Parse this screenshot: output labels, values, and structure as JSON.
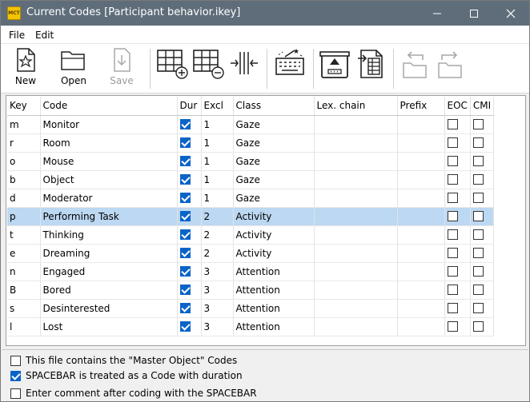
{
  "window": {
    "title": "Current Codes [Participant behavior.ikey]",
    "app_icon_text": "MCT"
  },
  "menu": [
    "File",
    "Edit"
  ],
  "toolbar": {
    "new_label": "New",
    "open_label": "Open",
    "save_label": "Save"
  },
  "table": {
    "headers": [
      "Key",
      "Code",
      "Dur",
      "Excl",
      "Class",
      "Lex. chain",
      "Prefix",
      "EOC",
      "CMI"
    ],
    "rows": [
      {
        "key": "m",
        "code": "Monitor",
        "dur": true,
        "excl": "1",
        "class": "Gaze",
        "lex": "",
        "prefix": "",
        "eoc": false,
        "cmi": false
      },
      {
        "key": "r",
        "code": "Room",
        "dur": true,
        "excl": "1",
        "class": "Gaze",
        "lex": "",
        "prefix": "",
        "eoc": false,
        "cmi": false
      },
      {
        "key": "o",
        "code": "Mouse",
        "dur": true,
        "excl": "1",
        "class": "Gaze",
        "lex": "",
        "prefix": "",
        "eoc": false,
        "cmi": false
      },
      {
        "key": "b",
        "code": "Object",
        "dur": true,
        "excl": "1",
        "class": "Gaze",
        "lex": "",
        "prefix": "",
        "eoc": false,
        "cmi": false
      },
      {
        "key": "d",
        "code": "Moderator",
        "dur": true,
        "excl": "1",
        "class": "Gaze",
        "lex": "",
        "prefix": "",
        "eoc": false,
        "cmi": false
      },
      {
        "key": "p",
        "code": "Performing Task",
        "dur": true,
        "excl": "2",
        "class": "Activity",
        "lex": "",
        "prefix": "",
        "eoc": false,
        "cmi": false,
        "selected": true
      },
      {
        "key": "t",
        "code": "Thinking",
        "dur": true,
        "excl": "2",
        "class": "Activity",
        "lex": "",
        "prefix": "",
        "eoc": false,
        "cmi": false
      },
      {
        "key": "e",
        "code": "Dreaming",
        "dur": true,
        "excl": "2",
        "class": "Activity",
        "lex": "",
        "prefix": "",
        "eoc": false,
        "cmi": false
      },
      {
        "key": "n",
        "code": "Engaged",
        "dur": true,
        "excl": "3",
        "class": "Attention",
        "lex": "",
        "prefix": "",
        "eoc": false,
        "cmi": false
      },
      {
        "key": "B",
        "code": "Bored",
        "dur": true,
        "excl": "3",
        "class": "Attention",
        "lex": "",
        "prefix": "",
        "eoc": false,
        "cmi": false
      },
      {
        "key": "s",
        "code": "Desinterested",
        "dur": true,
        "excl": "3",
        "class": "Attention",
        "lex": "",
        "prefix": "",
        "eoc": false,
        "cmi": false
      },
      {
        "key": "l",
        "code": "Lost",
        "dur": true,
        "excl": "3",
        "class": "Attention",
        "lex": "",
        "prefix": "",
        "eoc": false,
        "cmi": false
      }
    ]
  },
  "options": [
    {
      "label": "This file contains the \"Master Object\" Codes",
      "checked": false
    },
    {
      "label": "SPACEBAR is treated as a Code with duration",
      "checked": true
    },
    {
      "label": "Enter comment after coding with the SPACEBAR",
      "checked": false
    }
  ],
  "colors": {
    "titlebar": "#5f6d7a",
    "selected_row": "#bcd8f2",
    "checkbox_checked": "#0a64c8"
  }
}
